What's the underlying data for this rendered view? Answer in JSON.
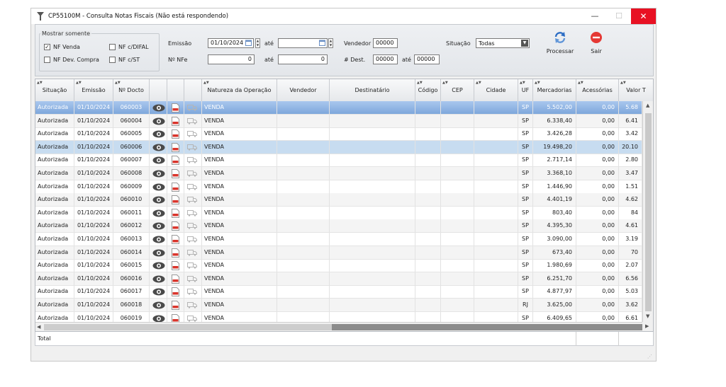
{
  "window": {
    "title": "CP55100M - Consulta Notas Fiscais (Não está respondendo)",
    "minimize": "—",
    "maximize": "☐",
    "close": "✕"
  },
  "filters": {
    "group_title": "Mostrar somente",
    "nf_venda": {
      "label": "NF Venda",
      "checked": true
    },
    "nf_difal": {
      "label": "NF c/DIFAL",
      "checked": false
    },
    "nf_dev_compra": {
      "label": "NF Dev. Compra",
      "checked": false
    },
    "nf_st": {
      "label": "NF c/ST",
      "checked": false
    },
    "emissao_label": "Emissão",
    "emissao_from": "01/10/2024",
    "ate_label": "até",
    "emissao_to": "",
    "nfe_label": "Nº NFe",
    "nfe_from": "0",
    "nfe_to": "0",
    "vendedor_label": "Vendedor",
    "vendedor_value": "00000",
    "dest_label": "# Dest.",
    "dest_from": "00000",
    "dest_to": "00000",
    "situacao_label": "Situação",
    "situacao_value": "Todas"
  },
  "toolbar": {
    "processar": "Processar",
    "sair": "Sair"
  },
  "grid": {
    "columns": [
      "Situação",
      "Emissão",
      "Nº Docto",
      "",
      "",
      "",
      "Natureza da Operação",
      "Vendedor",
      "Destinatário",
      "Código",
      "CEP",
      "Cidade",
      "UF",
      "Mercadorias",
      "Acessórias",
      "Valor T"
    ],
    "rows": [
      {
        "situacao": "Autorizada",
        "emissao": "01/10/2024",
        "docto": "060003",
        "natureza": "VENDA",
        "uf": "SP",
        "mercadorias": "5.502,00",
        "acessorias": "0,00",
        "valor": "5.68"
      },
      {
        "situacao": "Autorizada",
        "emissao": "01/10/2024",
        "docto": "060004",
        "natureza": "VENDA",
        "uf": "SP",
        "mercadorias": "6.338,40",
        "acessorias": "0,00",
        "valor": "6.41"
      },
      {
        "situacao": "Autorizada",
        "emissao": "01/10/2024",
        "docto": "060005",
        "natureza": "VENDA",
        "uf": "SP",
        "mercadorias": "3.426,28",
        "acessorias": "0,00",
        "valor": "3.42"
      },
      {
        "situacao": "Autorizada",
        "emissao": "01/10/2024",
        "docto": "060006",
        "natureza": "VENDA",
        "uf": "SP",
        "mercadorias": "19.498,20",
        "acessorias": "0,00",
        "valor": "20.10"
      },
      {
        "situacao": "Autorizada",
        "emissao": "01/10/2024",
        "docto": "060007",
        "natureza": "VENDA",
        "uf": "SP",
        "mercadorias": "2.717,14",
        "acessorias": "0,00",
        "valor": "2.80"
      },
      {
        "situacao": "Autorizada",
        "emissao": "01/10/2024",
        "docto": "060008",
        "natureza": "VENDA",
        "uf": "SP",
        "mercadorias": "3.368,10",
        "acessorias": "0,00",
        "valor": "3.47"
      },
      {
        "situacao": "Autorizada",
        "emissao": "01/10/2024",
        "docto": "060009",
        "natureza": "VENDA",
        "uf": "SP",
        "mercadorias": "1.446,90",
        "acessorias": "0,00",
        "valor": "1.51"
      },
      {
        "situacao": "Autorizada",
        "emissao": "01/10/2024",
        "docto": "060010",
        "natureza": "VENDA",
        "uf": "SP",
        "mercadorias": "4.401,19",
        "acessorias": "0,00",
        "valor": "4.62"
      },
      {
        "situacao": "Autorizada",
        "emissao": "01/10/2024",
        "docto": "060011",
        "natureza": "VENDA",
        "uf": "SP",
        "mercadorias": "803,40",
        "acessorias": "0,00",
        "valor": "84"
      },
      {
        "situacao": "Autorizada",
        "emissao": "01/10/2024",
        "docto": "060012",
        "natureza": "VENDA",
        "uf": "SP",
        "mercadorias": "4.395,30",
        "acessorias": "0,00",
        "valor": "4.61"
      },
      {
        "situacao": "Autorizada",
        "emissao": "01/10/2024",
        "docto": "060013",
        "natureza": "VENDA",
        "uf": "SP",
        "mercadorias": "3.090,00",
        "acessorias": "0,00",
        "valor": "3.19"
      },
      {
        "situacao": "Autorizada",
        "emissao": "01/10/2024",
        "docto": "060014",
        "natureza": "VENDA",
        "uf": "SP",
        "mercadorias": "673,40",
        "acessorias": "0,00",
        "valor": "70"
      },
      {
        "situacao": "Autorizada",
        "emissao": "01/10/2024",
        "docto": "060015",
        "natureza": "VENDA",
        "uf": "SP",
        "mercadorias": "1.980,69",
        "acessorias": "0,00",
        "valor": "2.07"
      },
      {
        "situacao": "Autorizada",
        "emissao": "01/10/2024",
        "docto": "060016",
        "natureza": "VENDA",
        "uf": "SP",
        "mercadorias": "6.251,70",
        "acessorias": "0,00",
        "valor": "6.56"
      },
      {
        "situacao": "Autorizada",
        "emissao": "01/10/2024",
        "docto": "060017",
        "natureza": "VENDA",
        "uf": "SP",
        "mercadorias": "4.877,97",
        "acessorias": "0,00",
        "valor": "5.03"
      },
      {
        "situacao": "Autorizada",
        "emissao": "01/10/2024",
        "docto": "060018",
        "natureza": "VENDA",
        "uf": "RJ",
        "mercadorias": "3.625,00",
        "acessorias": "0,00",
        "valor": "3.62"
      },
      {
        "situacao": "Autorizada",
        "emissao": "01/10/2024",
        "docto": "060019",
        "natureza": "VENDA",
        "uf": "SP",
        "mercadorias": "6.409,65",
        "acessorias": "0,00",
        "valor": "6.61"
      }
    ]
  },
  "footer": {
    "total_label": "Total"
  },
  "icons": {
    "view": "eye-icon",
    "pdf": "pdf-icon",
    "transport": "truck-icon",
    "refresh": "refresh-icon",
    "exit": "exit-icon"
  },
  "colors": {
    "close": "#e81123",
    "selected_row": "#7ea7dc",
    "highlight_row": "#c7dcf0",
    "exit": "#e53935",
    "refresh": "#2b6cc4"
  }
}
